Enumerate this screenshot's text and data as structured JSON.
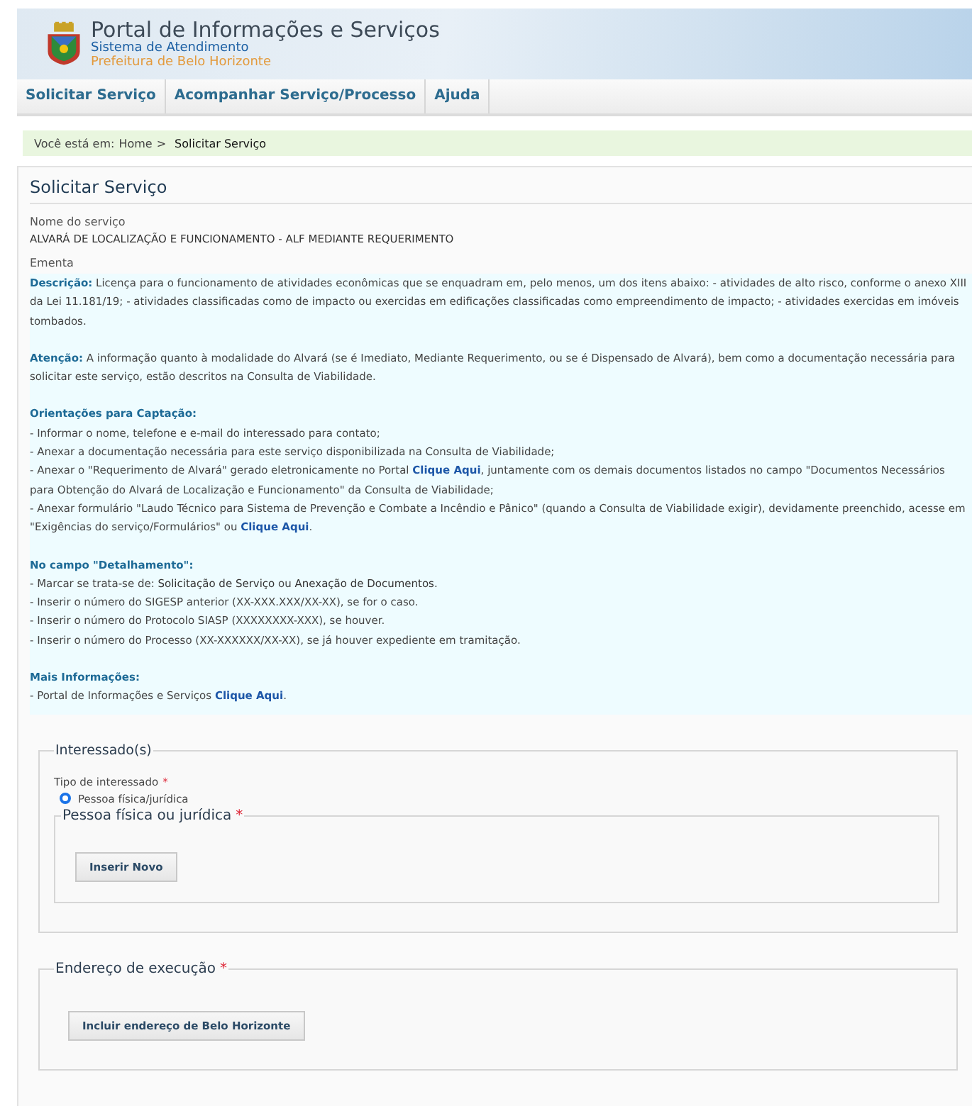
{
  "header": {
    "title": "Portal de Informações e Serviços",
    "subtitle": "Sistema de Atendimento",
    "org": "Prefeitura de Belo Horizonte"
  },
  "nav": [
    {
      "label": "Solicitar Serviço"
    },
    {
      "label": "Acompanhar Serviço/Processo"
    },
    {
      "label": "Ajuda"
    }
  ],
  "breadcrumb": {
    "prefix": "Você está em:",
    "home": "Home",
    "separator": ">",
    "current": "Solicitar Serviço"
  },
  "page_title": "Solicitar Serviço",
  "service": {
    "label": "Nome do serviço",
    "value": "ALVARÁ DE LOCALIZAÇÃO E FUNCIONAMENTO - ALF MEDIANTE REQUERIMENTO"
  },
  "ementa": {
    "label": "Ementa",
    "sections": [
      {
        "kind": "inline",
        "heading": "Descrição:",
        "lines": [
          [
            {
              "kind": "text",
              "text": "Licença para o funcionamento de atividades econômicas que se enquadram em, pelo menos, um dos itens abaixo: - atividades de alto risco, conforme o anexo XIII da Lei 11.181/19; - atividades classificadas como de impacto ou exercidas em edificações classificadas como empreendimento de impacto; - atividades exercidas em imóveis tombados."
            }
          ]
        ]
      },
      {
        "kind": "inline",
        "heading": "Atenção:",
        "lines": [
          [
            {
              "kind": "text",
              "text": "A informação quanto à modalidade do Alvará (se é Imediato, Mediante Requerimento, ou se é Dispensado de Alvará), bem como a documentação necessária para solicitar este serviço, estão descritos na Consulta de Viabilidade."
            }
          ]
        ]
      },
      {
        "kind": "block",
        "heading": "Orientações para Captação:",
        "lines": [
          [
            {
              "kind": "text",
              "text": "- Informar o nome, telefone e e-mail do interessado para contato;"
            }
          ],
          [
            {
              "kind": "text",
              "text": "- Anexar a documentação necessária para este serviço disponibilizada na Consulta de Viabilidade;"
            }
          ],
          [
            {
              "kind": "text",
              "text": "- Anexar o \"Requerimento de Alvará\" gerado eletronicamente no Portal "
            },
            {
              "kind": "link",
              "text": "Clique Aqui"
            },
            {
              "kind": "text",
              "text": ", juntamente com os demais documentos listados no campo \"Documentos Necessários para Obtenção do Alvará de Localização e Funcionamento\" da Consulta de Viabilidade;"
            }
          ],
          [
            {
              "kind": "text",
              "text": "- Anexar formulário \"Laudo Técnico para Sistema de Prevenção e Combate a Incêndio e Pânico\" (quando a Consulta de Viabilidade exigir), devidamente preenchido, acesse em \"Exigências do serviço/Formulários\" ou "
            },
            {
              "kind": "link",
              "text": "Clique Aqui"
            },
            {
              "kind": "text",
              "text": "."
            }
          ]
        ]
      },
      {
        "kind": "block",
        "heading": "No campo \"Detalhamento\":",
        "lines": [
          [
            {
              "kind": "text",
              "text": "- Marcar se trata-se de: **Solicitação de Serviço** ou **Anexação de Documentos**."
            }
          ],
          [
            {
              "kind": "text",
              "text": "- Inserir o número do SIGESP anterior (XX-XXX.XXX/XX-XX), se for o caso."
            }
          ],
          [
            {
              "kind": "text",
              "text": "- Inserir o número do Protocolo SIASP (XXXXXXXX-XXX), se houver."
            }
          ],
          [
            {
              "kind": "text",
              "text": "- Inserir o número do Processo (XX-XXXXXX/XX-XX), se já houver expediente em tramitação."
            }
          ]
        ]
      },
      {
        "kind": "block",
        "heading": "Mais Informações:",
        "lines": [
          [
            {
              "kind": "text",
              "text": "- Portal de Informações e Serviços "
            },
            {
              "kind": "link",
              "text": "Clique Aqui"
            },
            {
              "kind": "text",
              "text": "."
            }
          ]
        ]
      }
    ]
  },
  "interessados": {
    "legend": "Interessado(s)",
    "field_label": "Tipo de interessado",
    "required_mark": "*",
    "options": [
      {
        "label": "Pessoa física/jurídica",
        "selected": true
      }
    ],
    "subgroup": {
      "legend": "Pessoa física ou jurídica",
      "required_mark": "*",
      "button": "Inserir Novo"
    }
  },
  "endereco": {
    "legend": "Endereço de execução",
    "required_mark": "*",
    "button": "Incluir endereço de Belo Horizonte"
  }
}
